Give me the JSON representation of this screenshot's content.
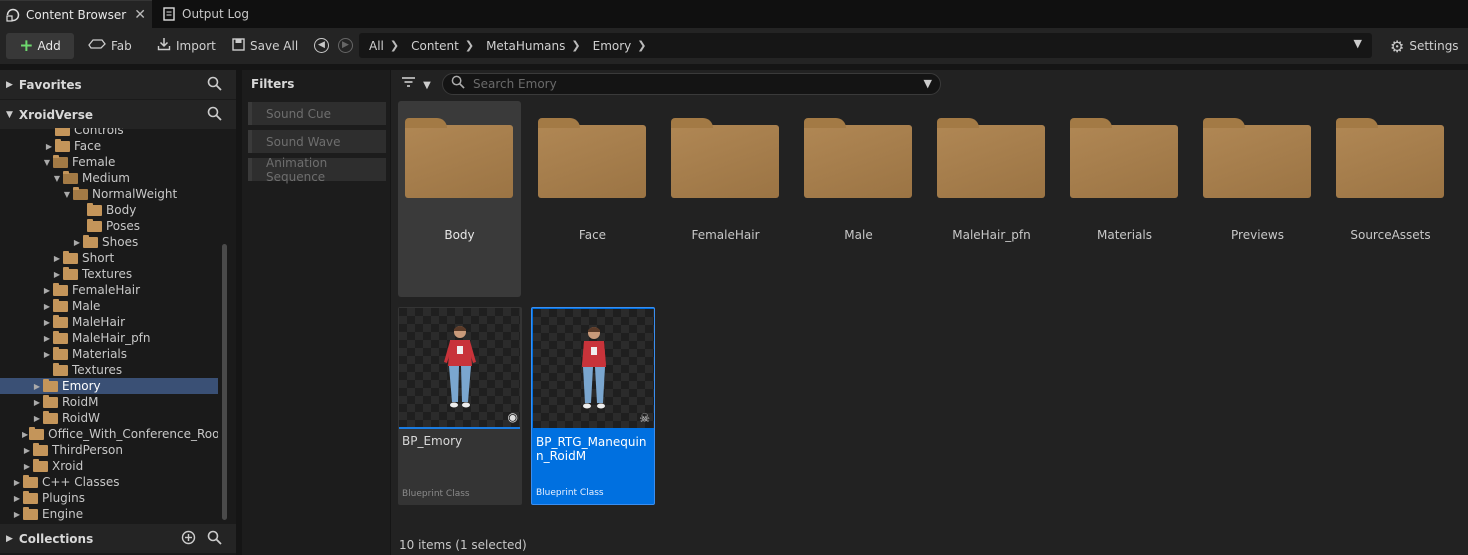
{
  "tabs": [
    {
      "label": "Content Browser",
      "close": "✕"
    },
    {
      "label": "Output Log"
    }
  ],
  "toolbar": {
    "add": "Add",
    "fab": "Fab",
    "import": "Import",
    "save_all": "Save All",
    "settings": "Settings"
  },
  "breadcrumb": [
    "All",
    "Content",
    "MetaHumans",
    "Emory"
  ],
  "left": {
    "favorites": "Favorites",
    "project": "XroidVerse",
    "collections": "Collections",
    "tree": [
      {
        "label": "Controls",
        "arrow": ""
      },
      {
        "label": "Face",
        "arrow": "▶"
      },
      {
        "label": "Female",
        "arrow": "▼"
      },
      {
        "label": "Medium",
        "arrow": "▼"
      },
      {
        "label": "NormalWeight",
        "arrow": "▼"
      },
      {
        "label": "Body",
        "arrow": ""
      },
      {
        "label": "Poses",
        "arrow": ""
      },
      {
        "label": "Shoes",
        "arrow": "▶"
      },
      {
        "label": "Short",
        "arrow": "▶"
      },
      {
        "label": "Textures",
        "arrow": "▶"
      },
      {
        "label": "FemaleHair",
        "arrow": "▶"
      },
      {
        "label": "Male",
        "arrow": "▶"
      },
      {
        "label": "MaleHair",
        "arrow": "▶"
      },
      {
        "label": "MaleHair_pfn",
        "arrow": "▶"
      },
      {
        "label": "Materials",
        "arrow": "▶"
      },
      {
        "label": "Textures",
        "arrow": ""
      },
      {
        "label": "Emory",
        "arrow": "▶"
      },
      {
        "label": "RoidM",
        "arrow": "▶"
      },
      {
        "label": "RoidW",
        "arrow": "▶"
      },
      {
        "label": "Office_With_Conference_Room",
        "arrow": "▶"
      },
      {
        "label": "ThirdPerson",
        "arrow": "▶"
      },
      {
        "label": "Xroid",
        "arrow": "▶"
      },
      {
        "label": "C++ Classes",
        "arrow": "▶"
      },
      {
        "label": "Plugins",
        "arrow": "▶"
      },
      {
        "label": "Engine",
        "arrow": "▶"
      }
    ]
  },
  "filters": {
    "title": "Filters",
    "items": [
      "Sound Cue",
      "Sound Wave",
      "Animation Sequence"
    ]
  },
  "search": {
    "placeholder": "Search Emory"
  },
  "folders": [
    "Body",
    "Face",
    "FemaleHair",
    "Male",
    "MaleHair_pfn",
    "Materials",
    "Previews",
    "SourceAssets"
  ],
  "assets": [
    {
      "name": "BP_Emory",
      "class": "Blueprint Class"
    },
    {
      "name": "BP_RTG_Manequinn_RoidM",
      "class": "Blueprint Class"
    }
  ],
  "status": "10 items (1 selected)",
  "colors": {
    "selection": "#0070e0",
    "folder": "#b08754",
    "add_plus": "#6ed86e"
  }
}
